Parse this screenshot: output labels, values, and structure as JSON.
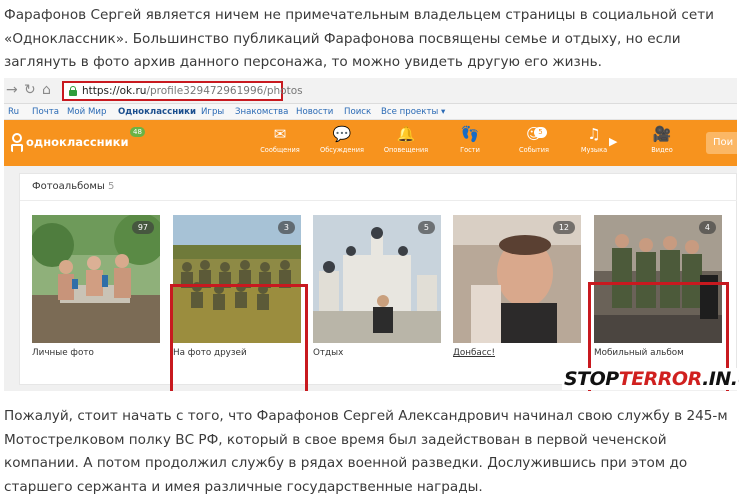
{
  "article": {
    "intro": "Фарафонов Сергей является ничем не примечательным владельцем страницы в социальной сети «Одноклассник». Большинство публикаций Фарафонова посвящены семье и отдыху, но если заглянуть в фото архив данного персонажа, то можно увидеть другую его жизнь.",
    "body": "Пожалуй, стоит начать с того, что Фарафонов Сергей Александрович начинал свою службу в 245-м Мотострелковом полку ВС РФ, который в свое время был задействован в первой чеченской компании. А потом продолжил службу в рядах военной разведки. Дослужившись при этом до старшего сержанта и имея различные государственные  награды."
  },
  "browser": {
    "url_host": "https://ok.ru",
    "url_path": "/profile329472961996/photos",
    "icons": [
      "back-arrow-icon",
      "reload-icon",
      "home-icon",
      "lock-icon"
    ]
  },
  "ok_menu": [
    "Ru",
    "Почта",
    "Мой Мир",
    "Одноклассники",
    "Игры",
    "Знакомства",
    "Новости",
    "Поиск",
    "Все проекты ▾"
  ],
  "ok_header": {
    "logo": "одноклассники",
    "badge": "48",
    "nav": [
      {
        "label": "Сообщения",
        "icon": "envelope-icon",
        "glyph": "✉",
        "count": ""
      },
      {
        "label": "Обсуждения",
        "icon": "chat-icon",
        "glyph": "💬",
        "count": ""
      },
      {
        "label": "Оповещения",
        "icon": "bell-icon",
        "glyph": "🔔",
        "count": ""
      },
      {
        "label": "Гости",
        "icon": "footprints-icon",
        "glyph": "👣",
        "count": ""
      },
      {
        "label": "События",
        "icon": "events-icon",
        "glyph": "5",
        "count": "5"
      },
      {
        "label": "Музыка",
        "icon": "music-icon",
        "glyph": "♫",
        "count": ""
      },
      {
        "label": "Видео",
        "icon": "video-camera-icon",
        "glyph": "🎥",
        "count": ""
      }
    ],
    "login": "Пои"
  },
  "albums": {
    "title": "Фотоальбомы",
    "count": "5",
    "items": [
      {
        "caption": "Личные фото",
        "count": "97",
        "underlined": false
      },
      {
        "caption": "На фото друзей",
        "count": "3",
        "underlined": false
      },
      {
        "caption": "Отдых",
        "count": "5",
        "underlined": false
      },
      {
        "caption": "Донбасс!",
        "count": "12",
        "underlined": true
      },
      {
        "caption": "Мобильный альбом",
        "count": "4",
        "underlined": false
      }
    ]
  },
  "watermark": {
    "a": "STOP",
    "b": "TERROR",
    "c": ".IN.UA"
  },
  "colors": {
    "highlight": "#c8191f",
    "ok_orange": "#f7931e",
    "link": "#2a6ab5"
  }
}
